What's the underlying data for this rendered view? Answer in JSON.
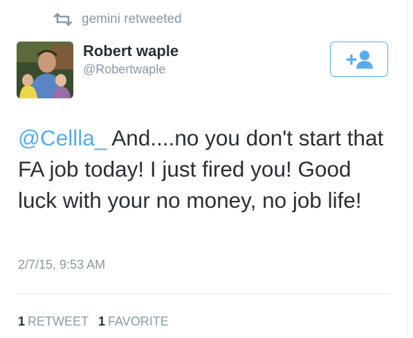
{
  "retweet_context": {
    "text": "gemini retweeted",
    "icon": "retweet-icon"
  },
  "author": {
    "name": "Robert waple",
    "handle": "@Robertwaple"
  },
  "follow_button": {
    "icon": "follow-user-icon",
    "accent": "#55acee"
  },
  "tweet": {
    "mention": "@Cellla_",
    "body": " And....no you don't start that FA job today!  I just fired you!  Good luck with your no money, no job life!"
  },
  "timestamp": "2/7/15, 9:53 AM",
  "stats": {
    "retweets": {
      "count": "1",
      "label": "RETWEET"
    },
    "favorites": {
      "count": "1",
      "label": "FAVORITE"
    }
  }
}
